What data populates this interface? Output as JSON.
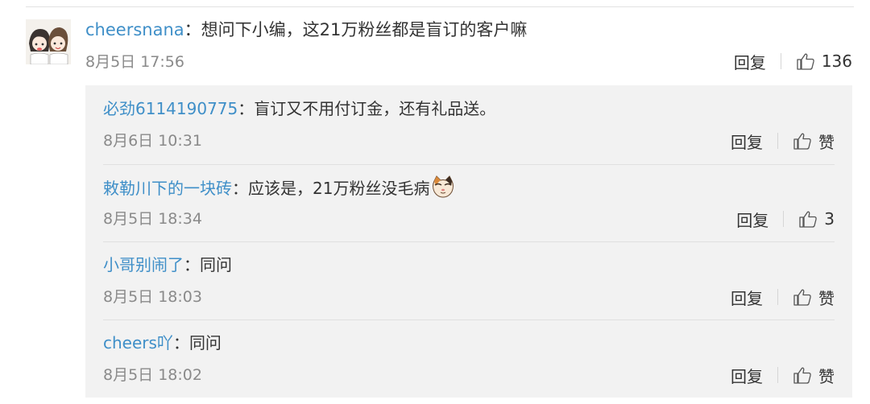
{
  "main_comment": {
    "username": "cheersnana",
    "separator": "：",
    "text": "想问下小编，这21万粉丝都是盲订的客户嘛",
    "time": "8月5日 17:56",
    "reply_label": "回复",
    "like_count": "136"
  },
  "replies": [
    {
      "username": "必劲6114190775",
      "separator": "：",
      "text": "盲订又不用付订金，还有礼品送。",
      "time": "8月6日 10:31",
      "reply_label": "回复",
      "like_label": "赞"
    },
    {
      "username": "敕勒川下的一块砖",
      "separator": "：",
      "text": "应该是，21万粉丝没毛病",
      "emoji": "cat-face-emoji",
      "time": "8月5日 18:34",
      "reply_label": "回复",
      "like_label": "3"
    },
    {
      "username": "小哥别闹了",
      "separator": "：",
      "text": "同问",
      "time": "8月5日 18:03",
      "reply_label": "回复",
      "like_label": "赞"
    },
    {
      "username": "cheers吖",
      "separator": "：",
      "text": "同问",
      "time": "8月5日 18:02",
      "reply_label": "回复",
      "like_label": "赞"
    }
  ],
  "colors": {
    "username": "#3f8fc8",
    "text": "#333333",
    "time": "#8a8a8a",
    "reply_box_bg": "#f2f2f2"
  }
}
